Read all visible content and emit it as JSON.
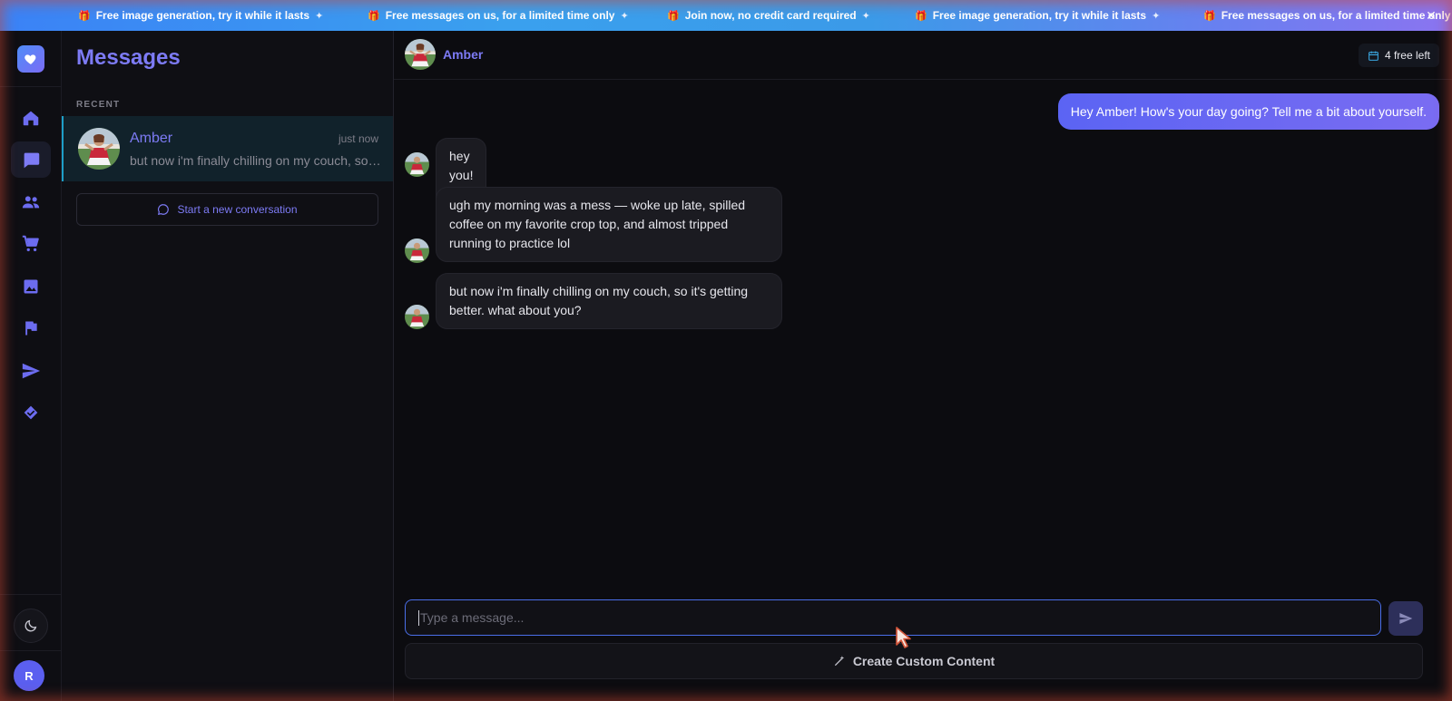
{
  "banner": {
    "items": [
      "Free image generation, try it while it lasts",
      "Free messages on us, for a limited time only",
      "Join now, no credit card required",
      "Free image generation, try it while it lasts",
      "Free messages on us, for a limited time only"
    ],
    "close_icon": "close-icon"
  },
  "rail": {
    "items": [
      {
        "icon": "home-icon"
      },
      {
        "icon": "chat-icon",
        "active": true
      },
      {
        "icon": "people-icon"
      },
      {
        "icon": "cart-icon"
      },
      {
        "icon": "image-icon"
      },
      {
        "icon": "flag-icon"
      },
      {
        "icon": "send-icon"
      },
      {
        "icon": "handshake-icon"
      }
    ],
    "theme_icon": "moon-icon",
    "user_initial": "R"
  },
  "list": {
    "title": "Messages",
    "recent_label": "RECENT",
    "conversations": [
      {
        "name": "Amber",
        "time": "just now",
        "preview": "but now i'm finally chilling on my couch, so it's getting better. what about you?"
      }
    ],
    "new_conversation_label": "Start a new conversation"
  },
  "chat": {
    "contact_name": "Amber",
    "free_left": "4 free left",
    "messages": [
      {
        "from": "user",
        "text": "Hey Amber! How's your day going? Tell me a bit about yourself."
      },
      {
        "from": "bot",
        "text": "hey you! 😊"
      },
      {
        "from": "bot",
        "text": "ugh my morning was a mess — woke up late, spilled coffee on my favorite crop top, and almost tripped running to practice lol"
      },
      {
        "from": "bot",
        "text": "but now i'm finally chilling on my couch, so it's getting better. what about you?"
      }
    ],
    "composer_placeholder": "Type a message...",
    "create_label": "Create Custom Content"
  },
  "colors": {
    "accent": "#7d7bf5",
    "banner_start": "#3b82f6",
    "banner_end": "#8b74f0",
    "user_bubble": "#5b64f3",
    "bot_bubble": "#1b1b21",
    "active_conversation": "#11222b"
  }
}
